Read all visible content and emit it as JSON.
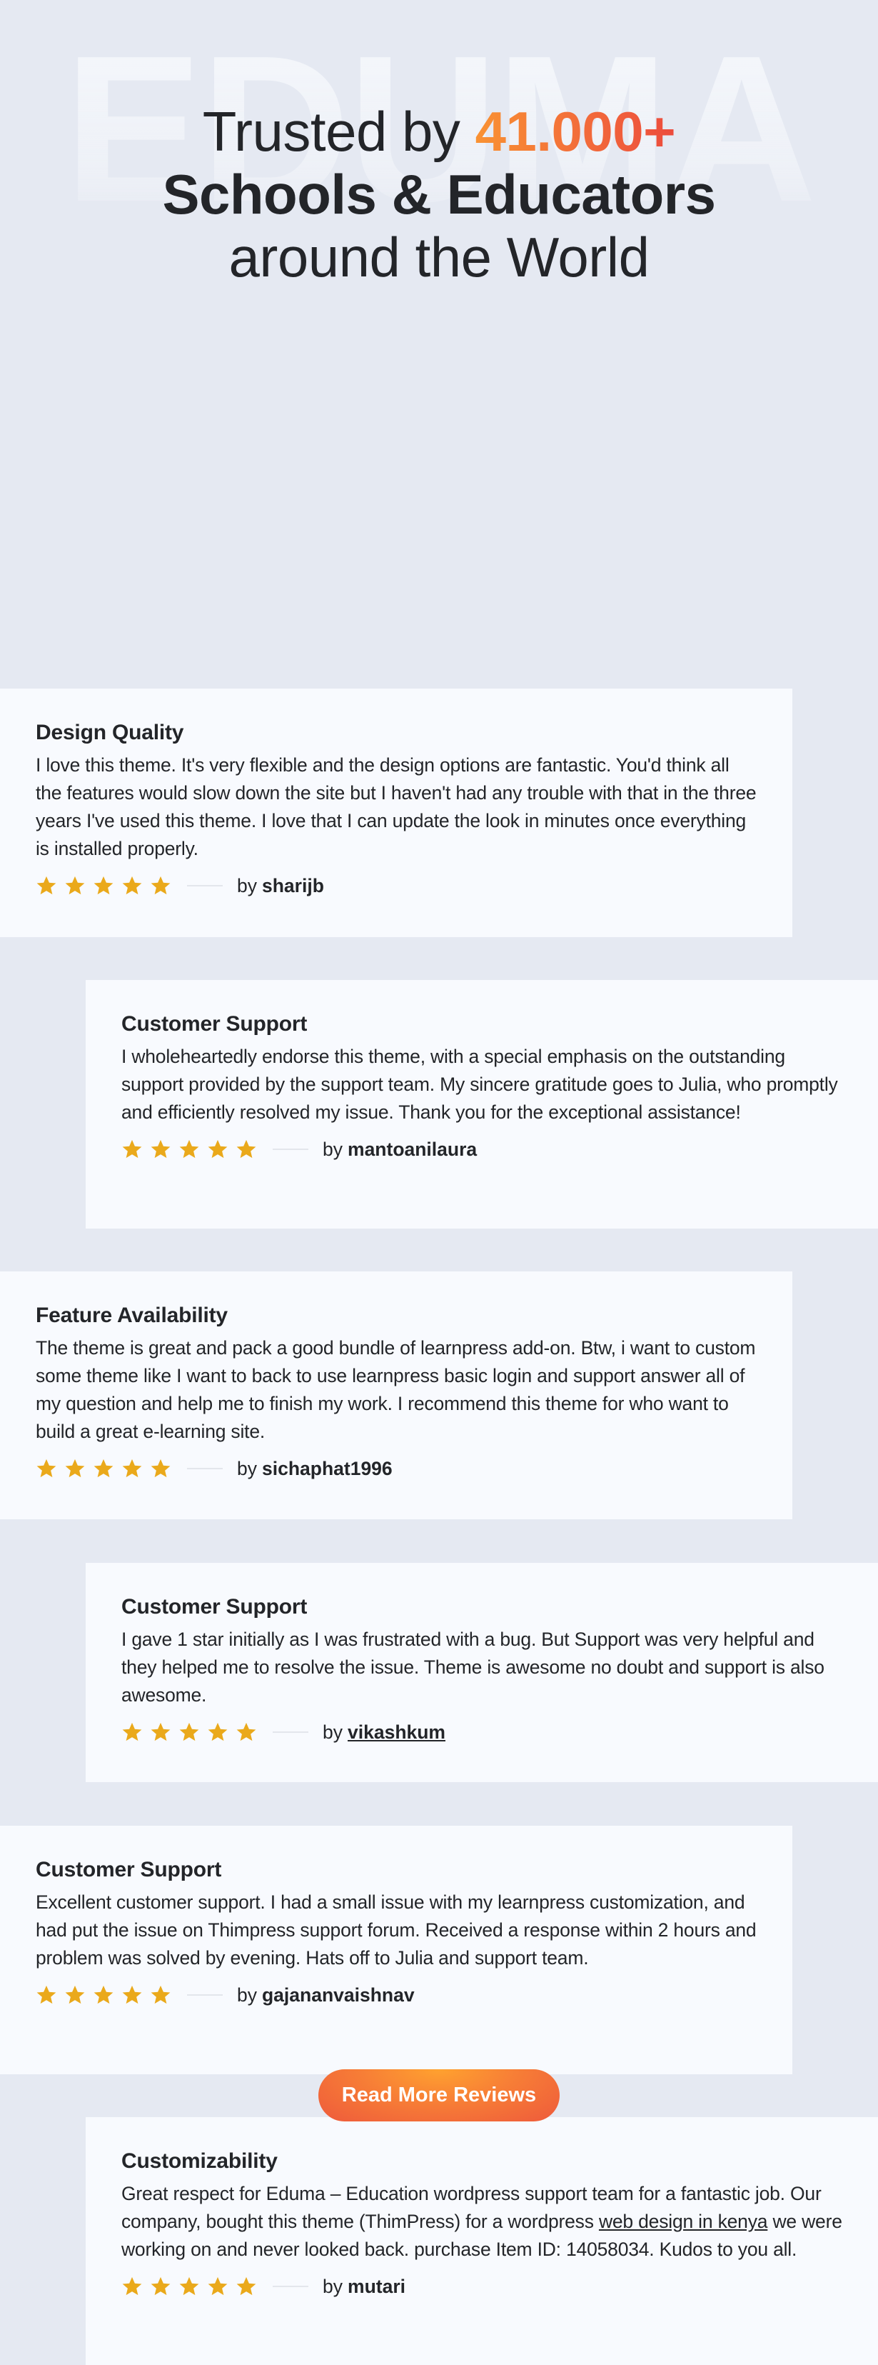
{
  "hero": {
    "watermark": "EDUMA",
    "line1_prefix": "Trusted by ",
    "line1_accent": "41.000+",
    "line2": "Schools & Educators",
    "line3": "around the World"
  },
  "colors": {
    "page_bg": "#e5e9f2",
    "card_bg": "#f8fafe",
    "text": "#232529",
    "star": "#eaa91b",
    "accent_start": "#f99233",
    "accent_end": "#ec4b3d"
  },
  "reviews": [
    {
      "title": "Design Quality",
      "body": "I love this theme. It's very flexible and the design options are fantastic. You'd think all the features would slow down the site but I haven't had any trouble with that in the three years I've used this theme. I love that I can update the look in minutes once everything is installed properly.",
      "rating": 5,
      "by_label": "by",
      "author": "sharijb"
    },
    {
      "title": "Customer Support",
      "body": "I wholeheartedly endorse this theme, with a special emphasis on the outstanding support provided by the support team. My sincere gratitude goes to Julia, who promptly and efficiently resolved my issue. Thank you for the exceptional assistance!",
      "rating": 5,
      "by_label": "by",
      "author": "mantoanilaura"
    },
    {
      "title": "Feature Availability",
      "body": "The theme is great and pack a good bundle of learnpress add-on. Btw, i want to custom some theme like I want to back to use learnpress basic login and support answer all of my question and help me to finish my work. I recommend this theme for who want to build a great e-learning site.",
      "rating": 5,
      "by_label": "by",
      "author": "sichaphat1996"
    },
    {
      "title": "Customer Support",
      "body": "I gave 1 star initially as I was frustrated with a bug. But Support was very helpful and they helped me to resolve the issue. Theme is awesome no doubt and support is also awesome.",
      "rating": 5,
      "by_label": "by",
      "author": "vikashkum"
    },
    {
      "title": "Customer Support",
      "body": "Excellent customer support. I had a small issue with my learnpress customization, and had put the issue on Thimpress support forum. Received a response within 2 hours and problem was solved by evening. Hats off to Julia and support team.",
      "rating": 5,
      "by_label": "by",
      "author": "gajananvaishnav"
    },
    {
      "title": "Customizability",
      "body_before_link": "Great respect for Eduma – Education wordpress support team for a fantastic job. Our company, bought this theme (ThimPress) for a wordpress ",
      "body_link": "web design in kenya",
      "body_after_link": " we were working on and never looked back. purchase Item ID: 14058034. Kudos to you all.",
      "rating": 5,
      "by_label": "by",
      "author": "mutari"
    }
  ],
  "cta": {
    "label": "Read More Reviews"
  }
}
